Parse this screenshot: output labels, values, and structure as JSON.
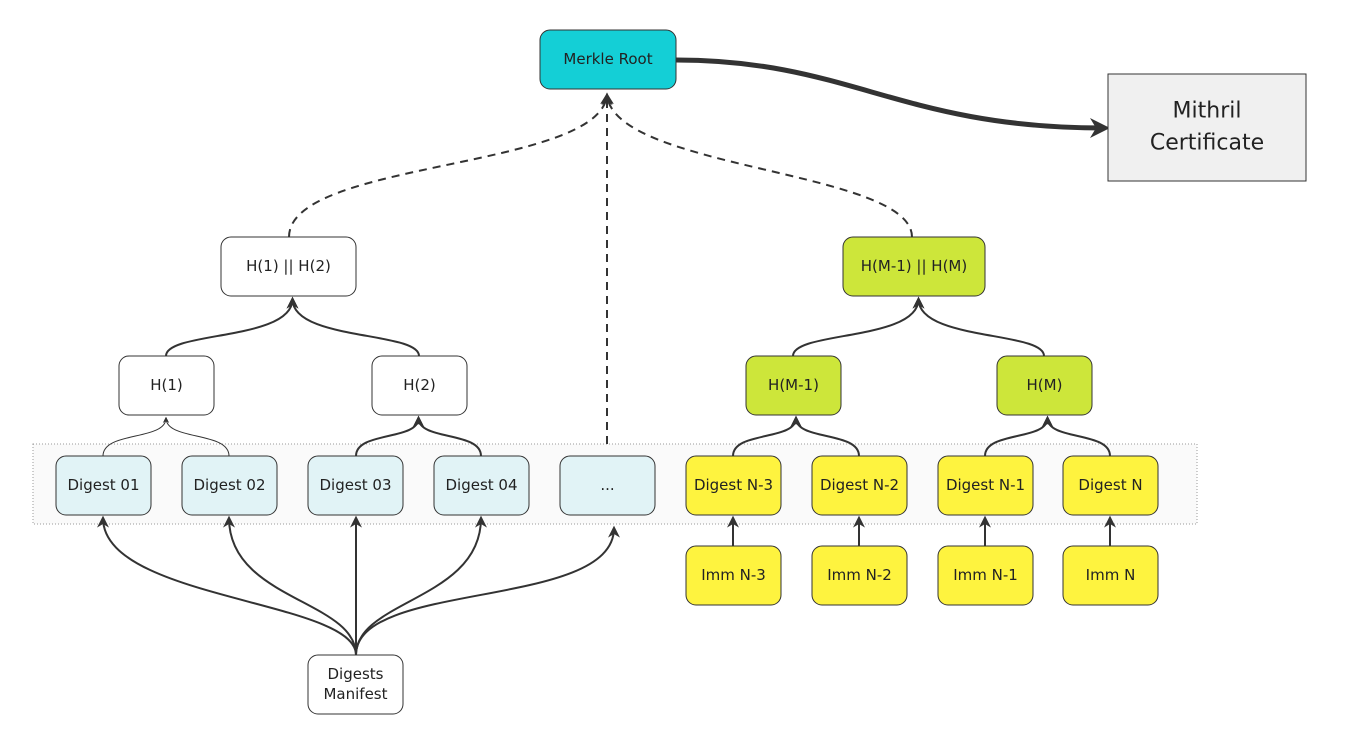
{
  "colors": {
    "root": "#14cfd6",
    "certificate": "#f0f0f0",
    "hash_plain": "#ffffff",
    "hash_green": "#cde63a",
    "digest_blue": "#e1f3f6",
    "digest_yellow": "#fef33f",
    "band": "#fafafa"
  },
  "nodes": {
    "merkle_root": "Merkle Root",
    "certificate_line1": "Mithril",
    "certificate_line2": "Certificate",
    "h12": "H(1) || H(2)",
    "hm1m": "H(M-1) || H(M)",
    "h1": "H(1)",
    "h2": "H(2)",
    "hm1": "H(M-1)",
    "hm": "H(M)",
    "digests": [
      "Digest 01",
      "Digest 02",
      "Digest 03",
      "Digest 04",
      "...",
      "Digest N-3",
      "Digest N-2",
      "Digest N-1",
      "Digest N"
    ],
    "imms": [
      "Imm N-3",
      "Imm N-2",
      "Imm N-1",
      "Imm N"
    ],
    "manifest_line1": "Digests",
    "manifest_line2": "Manifest"
  }
}
